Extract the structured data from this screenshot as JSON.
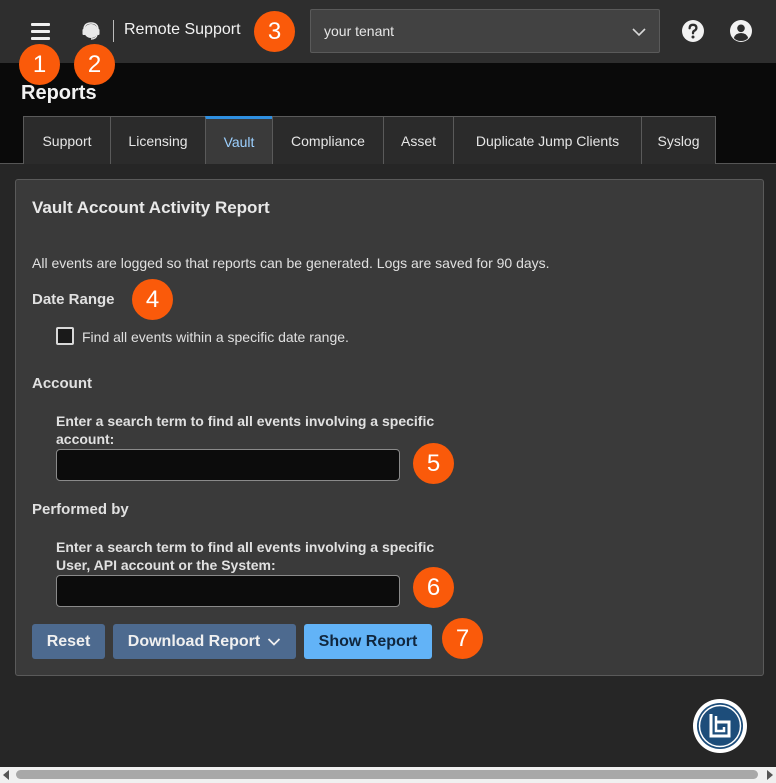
{
  "header": {
    "app_title": "Remote Support",
    "tenant_select": {
      "value": "your tenant"
    },
    "icons": [
      "menu-icon",
      "headset-icon",
      "help-icon",
      "user-account-icon"
    ]
  },
  "page": {
    "title": "Reports",
    "tabs": [
      {
        "label": "Support",
        "active": false
      },
      {
        "label": "Licensing",
        "active": false
      },
      {
        "label": "Vault",
        "active": true
      },
      {
        "label": "Compliance",
        "active": false
      },
      {
        "label": "Asset",
        "active": false
      },
      {
        "label": "Duplicate Jump Clients",
        "active": false
      },
      {
        "label": "Syslog",
        "active": false
      }
    ]
  },
  "report": {
    "title": "Vault Account Activity Report",
    "intro": "All events are logged so that reports can be generated. Logs are saved for 90 days.",
    "date_range": {
      "heading": "Date Range",
      "checkbox_label": "Find all events within a specific date range.",
      "checked": false
    },
    "account": {
      "heading": "Account",
      "field_label": "Enter a search term to find all events involving a specific account:",
      "value": ""
    },
    "performed_by": {
      "heading": "Performed by",
      "field_label": "Enter a search term to find all events involving a specific User, API account or the System:",
      "value": ""
    },
    "buttons": {
      "reset": "Reset",
      "download": "Download Report",
      "show": "Show Report"
    }
  },
  "callouts": [
    "1",
    "2",
    "3",
    "4",
    "5",
    "6",
    "7"
  ],
  "colors": {
    "accent": "#2f8fe0",
    "callout": "#fa5a0a",
    "primary_button": "#62b3f7",
    "secondary_button": "#4d6a8f"
  }
}
